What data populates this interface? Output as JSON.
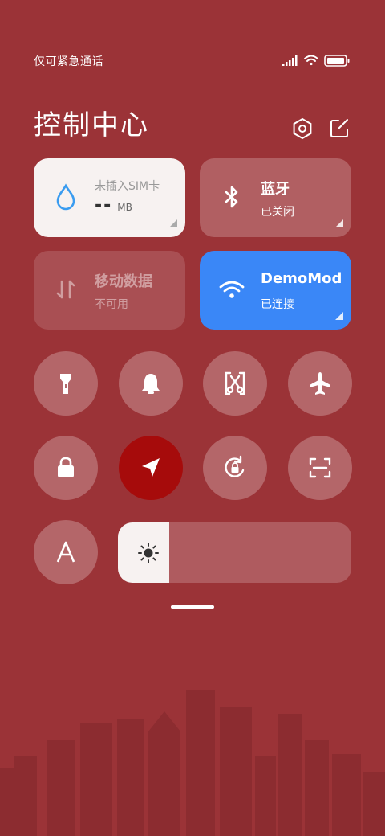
{
  "status_bar": {
    "text": "仅可紧急通话"
  },
  "header": {
    "title": "控制中心"
  },
  "tiles": {
    "data_usage": {
      "label": "未插入SIM卡",
      "value": "--",
      "unit": "MB"
    },
    "bluetooth": {
      "title": "蓝牙",
      "status": "已关闭"
    },
    "mobile_data": {
      "title": "移动数据",
      "status": "不可用"
    },
    "wifi": {
      "title": "DemoMod",
      "status": "已连接"
    }
  },
  "toggles": [
    {
      "name": "flashlight",
      "icon": "flashlight-icon"
    },
    {
      "name": "ringer",
      "icon": "bell-icon"
    },
    {
      "name": "screenshot",
      "icon": "scissors-icon"
    },
    {
      "name": "airplane-mode",
      "icon": "airplane-icon"
    },
    {
      "name": "lock-screen",
      "icon": "lock-icon"
    },
    {
      "name": "location",
      "icon": "location-arrow-icon",
      "active": true
    },
    {
      "name": "rotation-lock",
      "icon": "rotation-lock-icon"
    },
    {
      "name": "scanner",
      "icon": "scan-icon"
    },
    {
      "name": "auto-brightness",
      "icon": "letter-a-icon",
      "glyph": "A"
    }
  ],
  "brightness": {
    "level": 0.22
  },
  "colors": {
    "background": "#9b3337",
    "wifi_tile": "#3a87f7",
    "location_active": "#a60b0b",
    "tile_light": "#f7f2f1"
  }
}
